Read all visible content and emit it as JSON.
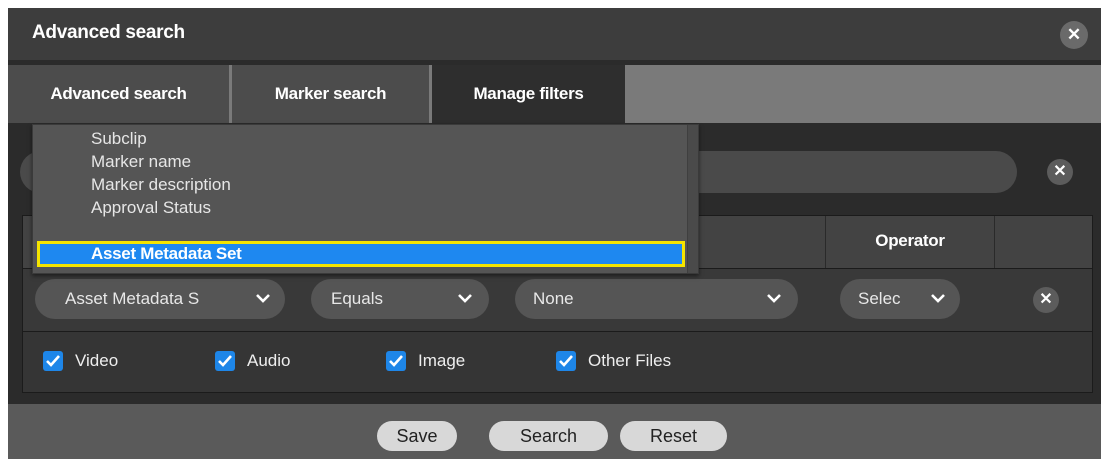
{
  "dialog": {
    "title": "Advanced search",
    "close_icon": "close-icon"
  },
  "tabs": [
    {
      "label": "Advanced search",
      "active": false
    },
    {
      "label": "Marker search",
      "active": false
    },
    {
      "label": "Manage filters",
      "active": true
    }
  ],
  "search": {
    "clear_icon": "close-icon"
  },
  "table": {
    "header_operator": "Operator",
    "row": {
      "field": "Asset Metadata S",
      "condition": "Equals",
      "value": "None",
      "operator": "Selec",
      "remove_icon": "close-icon"
    }
  },
  "file_types": [
    {
      "label": "Video",
      "checked": true
    },
    {
      "label": "Audio",
      "checked": true
    },
    {
      "label": "Image",
      "checked": true
    },
    {
      "label": "Other Files",
      "checked": true
    }
  ],
  "footer": {
    "save": "Save",
    "search": "Search",
    "reset": "Reset"
  },
  "dropdown": {
    "items": [
      "Subclip",
      "Marker name",
      "Marker description",
      "Approval Status"
    ],
    "selected": "Asset Metadata Set"
  },
  "colors": {
    "accent": "#1e88f0",
    "highlight_border": "#f5e400",
    "checkbox": "#1e86e8"
  }
}
